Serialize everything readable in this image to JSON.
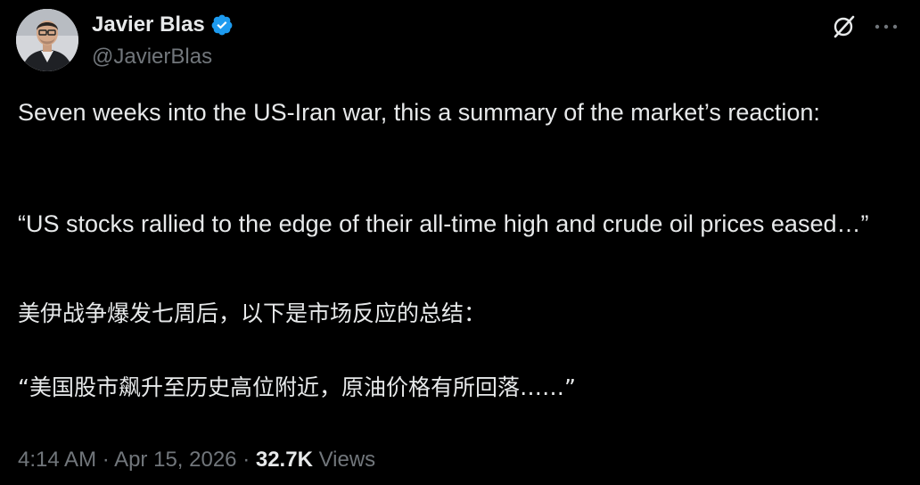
{
  "author": {
    "name": "Javier Blas",
    "handle": "@JavierBlas",
    "verified": true
  },
  "icons": {
    "verified": "verified-badge-icon",
    "grok": "grok-icon",
    "more": "more-options-icon"
  },
  "colors": {
    "background": "#000000",
    "text": "#e7e9ea",
    "secondary_text": "#71767b",
    "verified_badge": "#1d9bf0"
  },
  "post": {
    "paragraph_1": "Seven weeks into the US-Iran war, this a summary of the market’s reaction:",
    "paragraph_2": "“US stocks rallied to the edge of their all-time high and crude oil prices eased…”",
    "paragraph_3": "美伊战争爆发七周后，以下是市场反应的总结：",
    "paragraph_4": "“美国股市飙升至历史高位附近，原油价格有所回落……”"
  },
  "meta": {
    "time": "4:14 AM",
    "separator": "·",
    "date": "Apr 15, 2026",
    "views_count": "32.7K",
    "views_label": "Views"
  }
}
